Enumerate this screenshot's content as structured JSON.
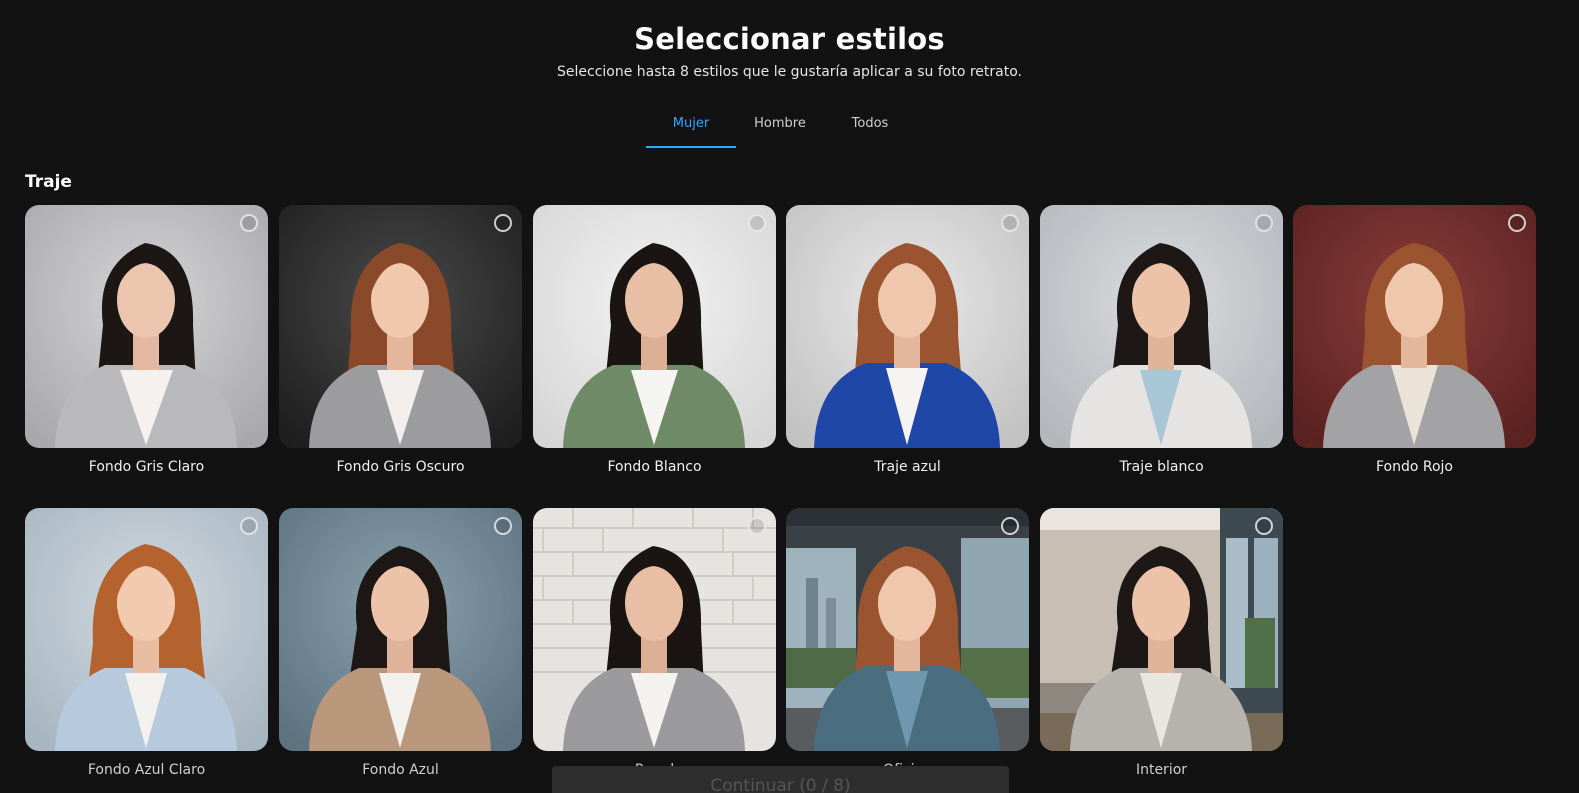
{
  "header": {
    "title": "Seleccionar estilos",
    "subtitle": "Seleccione hasta 8 estilos que le gustaría aplicar a su foto retrato."
  },
  "tabs": [
    {
      "label": "Mujer",
      "active": true
    },
    {
      "label": "Hombre",
      "active": false
    },
    {
      "label": "Todos",
      "active": false
    }
  ],
  "section": {
    "title": "Traje"
  },
  "styles": [
    {
      "label": "Fondo Gris Claro",
      "selected": false
    },
    {
      "label": "Fondo Gris Oscuro",
      "selected": false
    },
    {
      "label": "Fondo Blanco",
      "selected": false
    },
    {
      "label": "Traje azul",
      "selected": false
    },
    {
      "label": "Traje blanco",
      "selected": false
    },
    {
      "label": "Fondo Rojo",
      "selected": false
    },
    {
      "label": "Fondo Azul Claro",
      "selected": false
    },
    {
      "label": "Fondo Azul",
      "selected": false
    },
    {
      "label": "Pared",
      "selected": false
    },
    {
      "label": "Oficina",
      "selected": false
    },
    {
      "label": "Interior",
      "selected": false
    }
  ],
  "footer": {
    "continue_label": "Continuar (0 / 8)"
  },
  "colors": {
    "background": "#121212",
    "accent": "#2ea7ff",
    "text": "#ffffff"
  }
}
